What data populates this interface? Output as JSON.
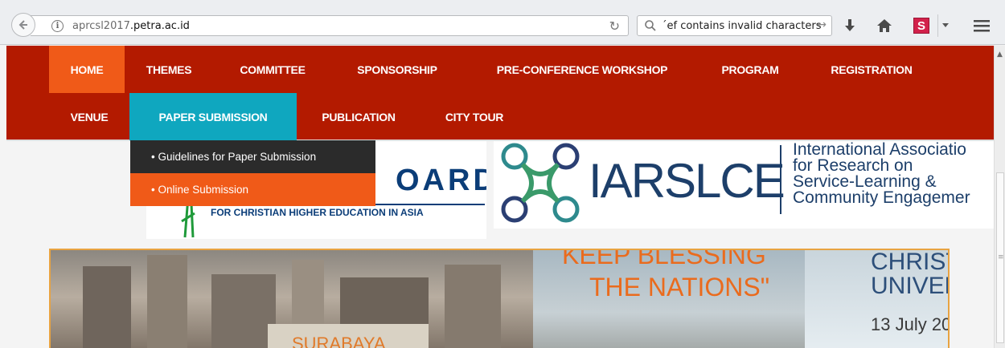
{
  "browser": {
    "url_host_prefix": "aprcsl2017",
    "url_host_domain": ".petra.ac.id",
    "search_value": "ef contains invalid characters",
    "search_prefix": "´"
  },
  "nav": {
    "items": [
      {
        "label": "HOME",
        "state": "active"
      },
      {
        "label": "THEMES"
      },
      {
        "label": "COMMITTEE"
      },
      {
        "label": "SPONSORSHIP"
      },
      {
        "label": "PRE-CONFERENCE WORKSHOP"
      },
      {
        "label": "PROGRAM"
      },
      {
        "label": "REGISTRATION"
      },
      {
        "label": "VENUE"
      },
      {
        "label": "PAPER SUBMISSION",
        "state": "open"
      },
      {
        "label": "PUBLICATION"
      },
      {
        "label": "CITY TOUR"
      }
    ],
    "dropdown": [
      {
        "label": "• Guidelines for Paper Submission"
      },
      {
        "label": "• Online Submission",
        "state": "highlighted"
      }
    ]
  },
  "logos": {
    "united_board_word": "OARD",
    "united_board_sub": "FOR CHRISTIAN HIGHER EDUCATION IN ASIA",
    "iarslce_name": "IARSLCE",
    "iarslce_line1": "International Associatio",
    "iarslce_line2": "for Research on",
    "iarslce_line3": "Service-Learning &",
    "iarslce_line4": "Community Engagemer"
  },
  "hero": {
    "banner_line1": "KEEP BLESSING",
    "banner_line2": "THE NATIONS\"",
    "right_line1": "CHRIST",
    "right_line2": "UNIVER",
    "right_line3": "13 July 20",
    "city_text": "SURABAYA"
  },
  "colors": {
    "nav_bg": "#b31a00",
    "active": "#f05a18",
    "open": "#0fa7bf",
    "dropdown_dark": "#2b2b2b"
  }
}
